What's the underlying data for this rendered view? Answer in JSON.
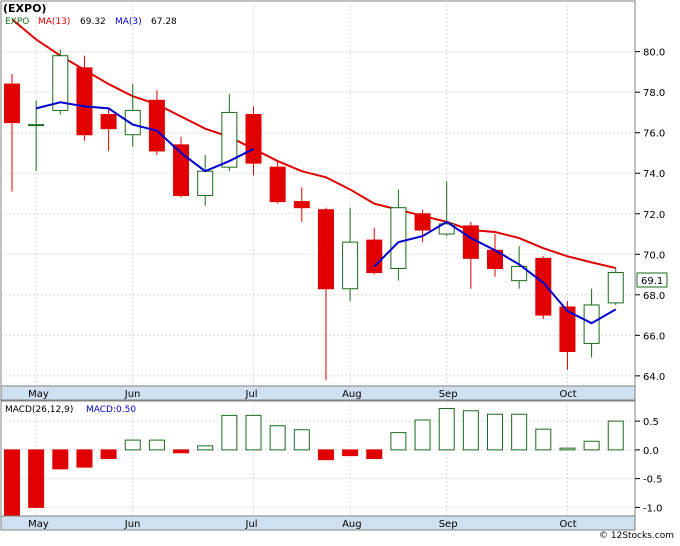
{
  "title": "(EXPO)",
  "legend": {
    "symbol": "EXPO",
    "ma13_label": "MA(13)",
    "ma13_value": "69.32",
    "ma3_label": "MA(3)",
    "ma3_value": "67.28",
    "macd_label": "MACD(26,12,9)",
    "macd_value_label": "MACD:0.50"
  },
  "footer": "© 12Stocks.com",
  "colors": {
    "up": "#1a6b1a",
    "down": "#e00000",
    "ma13": "#e00000",
    "ma3": "#0000cc",
    "axis_bar": "#cfe0f0",
    "grid": "#d8d8d8"
  },
  "chart_data": [
    {
      "type": "candlestick",
      "x_tick_labels": [
        "May",
        "Jun",
        "Jul",
        "Aug",
        "Sep",
        "Oct"
      ],
      "x_tick_index": [
        1,
        5,
        10,
        14,
        18,
        23
      ],
      "ylim": [
        63.5,
        82.5
      ],
      "y_ticks": [
        64.0,
        66.0,
        68.0,
        70.0,
        72.0,
        74.0,
        76.0,
        78.0,
        80.0
      ],
      "last_price_label": "69.1",
      "last_price": 69.1,
      "candles": [
        {
          "o": 78.4,
          "h": 78.9,
          "l": 73.1,
          "c": 76.5
        },
        {
          "o": 76.4,
          "h": 77.6,
          "l": 74.1,
          "c": 76.4
        },
        {
          "o": 77.1,
          "h": 80.1,
          "l": 76.9,
          "c": 79.8
        },
        {
          "o": 79.2,
          "h": 79.8,
          "l": 75.6,
          "c": 75.9
        },
        {
          "o": 76.9,
          "h": 77.2,
          "l": 75.1,
          "c": 76.2
        },
        {
          "o": 75.9,
          "h": 78.4,
          "l": 75.3,
          "c": 77.1
        },
        {
          "o": 77.6,
          "h": 78.1,
          "l": 74.9,
          "c": 75.1
        },
        {
          "o": 75.4,
          "h": 75.8,
          "l": 72.8,
          "c": 72.9
        },
        {
          "o": 72.9,
          "h": 74.9,
          "l": 72.4,
          "c": 74.1
        },
        {
          "o": 74.3,
          "h": 77.9,
          "l": 74.1,
          "c": 77.0
        },
        {
          "o": 76.9,
          "h": 77.3,
          "l": 73.9,
          "c": 74.5
        },
        {
          "o": 74.3,
          "h": 74.6,
          "l": 72.5,
          "c": 72.6
        },
        {
          "o": 72.6,
          "h": 73.3,
          "l": 71.6,
          "c": 72.3
        },
        {
          "o": 72.2,
          "h": 72.3,
          "l": 63.8,
          "c": 68.3
        },
        {
          "o": 68.3,
          "h": 72.3,
          "l": 67.7,
          "c": 70.6
        },
        {
          "o": 70.7,
          "h": 71.3,
          "l": 69.0,
          "c": 69.1
        },
        {
          "o": 69.3,
          "h": 73.2,
          "l": 68.7,
          "c": 72.3
        },
        {
          "o": 72.0,
          "h": 72.2,
          "l": 70.6,
          "c": 71.2
        },
        {
          "o": 71.0,
          "h": 73.6,
          "l": 70.9,
          "c": 71.5
        },
        {
          "o": 71.4,
          "h": 71.6,
          "l": 68.3,
          "c": 69.8
        },
        {
          "o": 70.2,
          "h": 71.0,
          "l": 68.9,
          "c": 69.3
        },
        {
          "o": 68.7,
          "h": 70.4,
          "l": 68.3,
          "c": 69.4
        },
        {
          "o": 69.8,
          "h": 69.9,
          "l": 66.8,
          "c": 67.0
        },
        {
          "o": 67.4,
          "h": 67.7,
          "l": 64.3,
          "c": 65.2
        },
        {
          "o": 65.6,
          "h": 68.3,
          "l": 64.9,
          "c": 67.5
        },
        {
          "o": 67.6,
          "h": 69.3,
          "l": 67.5,
          "c": 69.1
        }
      ],
      "ma13": [
        81.6,
        80.6,
        79.8,
        79.1,
        78.4,
        77.8,
        77.4,
        76.8,
        76.2,
        75.8,
        75.2,
        74.6,
        74.1,
        73.8,
        73.2,
        72.5,
        72.2,
        71.9,
        71.6,
        71.2,
        71.1,
        70.8,
        70.3,
        69.9,
        69.6,
        69.32
      ],
      "ma3": [
        null,
        77.2,
        77.5,
        77.3,
        77.2,
        76.4,
        76.1,
        75.0,
        74.1,
        74.6,
        75.2,
        null,
        null,
        null,
        null,
        69.4,
        70.6,
        70.9,
        71.6,
        70.8,
        70.2,
        69.5,
        68.6,
        67.2,
        66.6,
        67.28
      ]
    },
    {
      "type": "bar",
      "title": "MACD(26,12,9)",
      "ylim": [
        -1.15,
        0.85
      ],
      "y_ticks": [
        -1.0,
        -0.5,
        0.0,
        0.5
      ],
      "y_tick_labels": [
        "-1.0",
        "-0.5",
        "0.0",
        "0.5"
      ],
      "x_tick_labels": [
        "May",
        "Jun",
        "Jul",
        "Aug",
        "Sep",
        "Oct"
      ],
      "x_tick_index": [
        1,
        5,
        10,
        14,
        18,
        23
      ],
      "values": [
        -1.15,
        -1.0,
        -0.33,
        -0.3,
        -0.15,
        0.17,
        0.17,
        -0.05,
        0.07,
        0.6,
        0.6,
        0.42,
        0.35,
        -0.17,
        -0.1,
        -0.15,
        0.3,
        0.52,
        0.72,
        0.68,
        0.62,
        0.62,
        0.36,
        0.03,
        0.15,
        0.5
      ]
    }
  ]
}
